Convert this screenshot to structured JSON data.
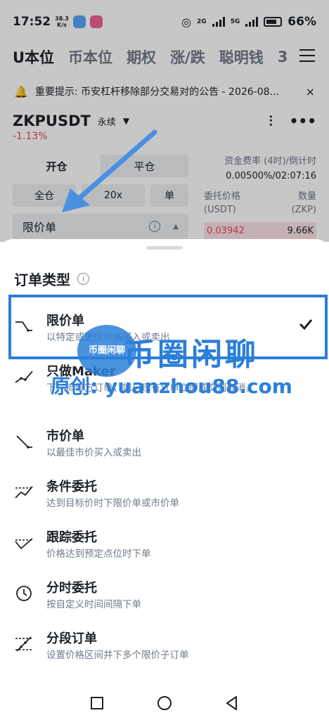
{
  "status_bar": {
    "time": "17:52",
    "speed_value": "38.3",
    "speed_unit": "K/s",
    "network_1": "2G",
    "network_2": "5G",
    "battery": "66%"
  },
  "top_tabs": [
    "U本位",
    "币本位",
    "期权",
    "涨/跌",
    "聪明钱",
    "3"
  ],
  "notice": {
    "text": "重要提示: 币安杠杆移除部分交易对的公告 - 2026-08...",
    "close": "×"
  },
  "pair": {
    "symbol": "ZKPUSDT",
    "type": "永续",
    "change": "-1.13%"
  },
  "left_panel": {
    "open": "开仓",
    "close": "平仓",
    "margin_mode": "全仓",
    "leverage": "20x",
    "position_mode": "单",
    "order_type": "限价单"
  },
  "right_panel": {
    "funding_label": "资金费率 (4时)/倒计时",
    "funding_value": "0.00500%/02:07:16",
    "price_label": "委托价格",
    "qty_label": "数量",
    "price_unit": "(USDT)",
    "qty_unit": "(ZKP)",
    "ask_price": "0.03942",
    "ask_qty": "9.66K"
  },
  "sheet": {
    "title": "订单类型",
    "options": [
      {
        "name": "限价单",
        "desc": "以特定或更优价格买入或卖出",
        "selected": true
      },
      {
        "name": "只做Maker",
        "desc": "下一流单方订单，如与现有订单立即成交则取消。"
      },
      {
        "name": "市价单",
        "desc": "以最佳市价买入或卖出"
      },
      {
        "name": "条件委托",
        "desc": "达到目标价时下限价单或市价单"
      },
      {
        "name": "跟踪委托",
        "desc": "价格达到预定点位时下单"
      },
      {
        "name": "分时委托",
        "desc": "按自定义时间间隔下单"
      },
      {
        "name": "分段订单",
        "desc": "设置价格区间并下多个限价子订单"
      }
    ]
  },
  "watermark": {
    "logo": "币圈闲聊",
    "title": "币圈闲聊",
    "url": "原创: yuanzhou88.com"
  },
  "colors": {
    "accent_blue": "#2b7fd9",
    "sell_red": "#f6465d",
    "brand_yellow": "#f0b90b"
  }
}
